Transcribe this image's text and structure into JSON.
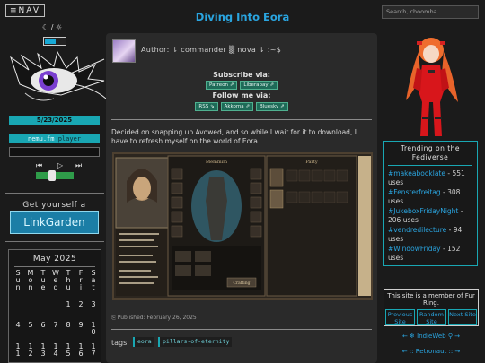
{
  "nav": {
    "label": "≡NAV"
  },
  "theme": {
    "icons": "☾ / ☼"
  },
  "date": "5/23/2025",
  "player": {
    "name": "nemu.fm",
    "label": "player",
    "prev": "⏮",
    "play": "▷",
    "next": "⏭"
  },
  "linkgarden": {
    "prompt": "Get yourself a",
    "button": "LinkGarden"
  },
  "calendar": {
    "title": "May 2025",
    "weekdays": [
      "S\nu\nn",
      "M\no\nn",
      "T\nu\ne",
      "W\ne\nd",
      "T\nh\nu",
      "F\nr\ni",
      "S\na\nt"
    ],
    "rows": [
      [
        "",
        "",
        "",
        "",
        "1",
        "2",
        "3"
      ],
      [
        "4",
        "5",
        "6",
        "7",
        "8",
        "9",
        "1\n0"
      ],
      [
        "1\n1",
        "1\n2",
        "1\n3",
        "1\n4",
        "1\n5",
        "1\n6",
        "1\n7"
      ]
    ]
  },
  "post": {
    "title": "Diving Into Eora",
    "author": "Author: ⇂ commander ▒ nova ⇂ :~$",
    "subscribe_heading": "Subscribe via:",
    "subscribe": [
      "Patreon ⇗",
      "Liberapay ⇗"
    ],
    "follow_heading": "Follow me via:",
    "follow": [
      "RSS ⇘",
      "Akkoma ⇗",
      "Bluesky ⇗"
    ],
    "body": "Decided on snapping up Avowed, and so while I wait for it to download, I have to refresh myself on the world of Eora",
    "published": "⎘ Published: February 26, 2025",
    "tags_label": "tags:",
    "tags": [
      "eora",
      "pillars-of-eternity"
    ]
  },
  "game_screen": {
    "panel_title": "Memmim",
    "party_label": "Party",
    "button": "Crafting"
  },
  "search": {
    "placeholder": "Search, choomba..."
  },
  "trending": {
    "title": "Trending on the Fediverse",
    "items": [
      {
        "tag": "#makeabooklate",
        "count": "- 551 uses"
      },
      {
        "tag": "#Fensterfreitag",
        "count": "- 308 uses"
      },
      {
        "tag": "#JukeboxFridayNight",
        "count": "- 206 uses"
      },
      {
        "tag": "#vendredilecture",
        "count": "- 94 uses"
      },
      {
        "tag": "#WindowFriday",
        "count": "- 152 uses"
      }
    ]
  },
  "webring": {
    "text": "This site is a member of Fur Ring.",
    "prev": "Previous Site",
    "random": "Random Site",
    "next": "Next Site",
    "indieweb": "← ❄ IndieWeb ⚲ →",
    "retronaut": "← :: Retronaut :: →"
  },
  "colors": {
    "accent": "#19a7b3",
    "link": "#2aa5e0",
    "card": "#2a2a2a",
    "background": "#1b1b1b"
  }
}
